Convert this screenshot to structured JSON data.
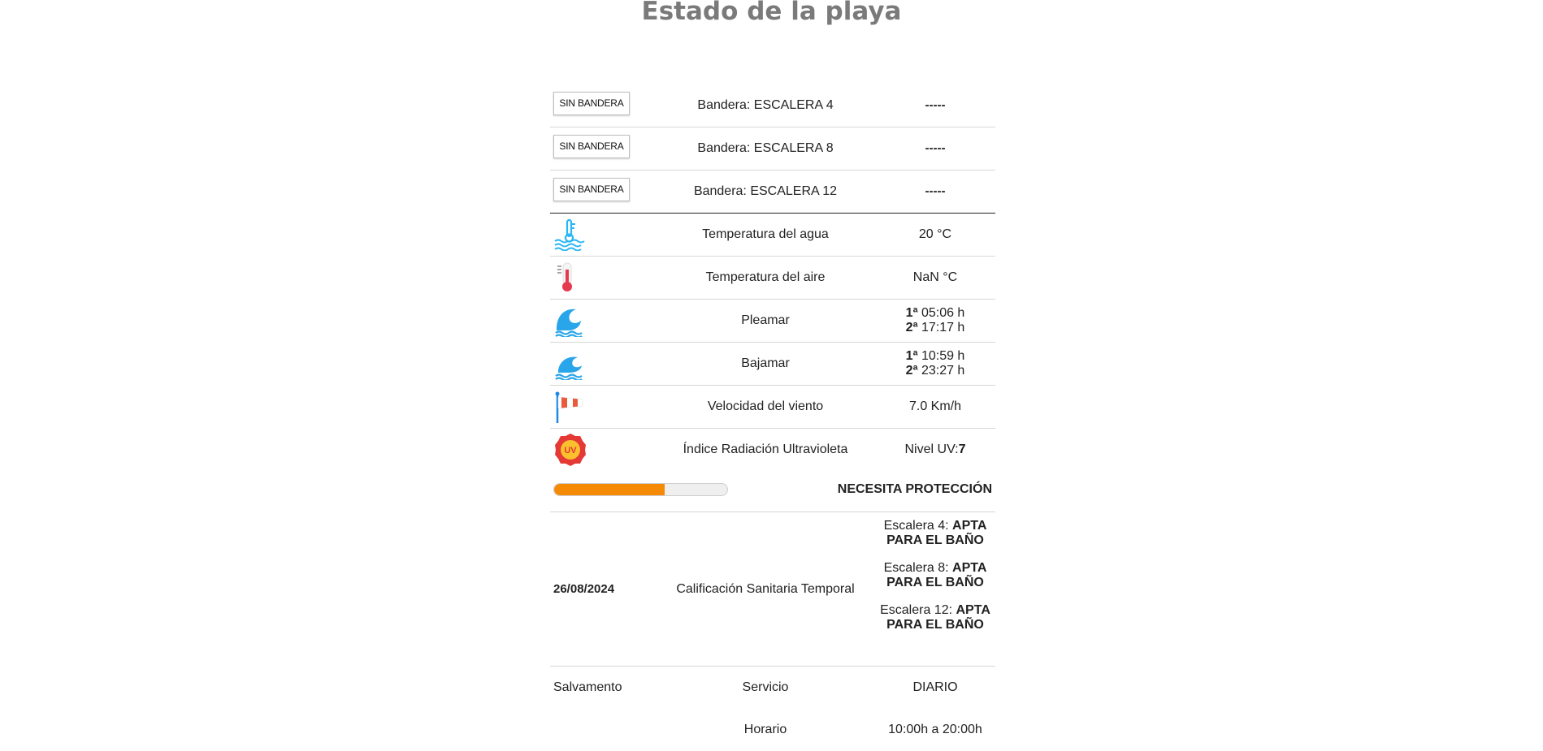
{
  "page_title": "Estado de la playa",
  "flags": [
    {
      "badge": "SIN BANDERA",
      "label": "Bandera: ESCALERA 4",
      "value": "-----"
    },
    {
      "badge": "SIN BANDERA",
      "label": "Bandera: ESCALERA 8",
      "value": "-----"
    },
    {
      "badge": "SIN BANDERA",
      "label": "Bandera: ESCALERA 12",
      "value": "-----"
    }
  ],
  "water_temp": {
    "icon": "water-thermometer-icon",
    "label": "Temperatura del agua",
    "value": "20 °C"
  },
  "air_temp": {
    "icon": "thermometer-icon",
    "label": "Temperatura del aire",
    "value": "NaN °C"
  },
  "high_tide": {
    "icon": "wave-icon",
    "label": "Pleamar",
    "first_ord": "1ª",
    "first_time": " 05:06 h",
    "second_ord": "2ª",
    "second_time": " 17:17 h"
  },
  "low_tide": {
    "icon": "low-wave-icon",
    "label": "Bajamar",
    "first_ord": "1ª",
    "first_time": " 10:59 h",
    "second_ord": "2ª",
    "second_time": " 23:27 h"
  },
  "wind": {
    "icon": "windsock-icon",
    "label": "Velocidad del viento",
    "value": "7.0 Km/h"
  },
  "uv": {
    "icon": "uv-icon",
    "icon_text": "UV",
    "label": "Índice Radiación Ultravioleta",
    "value_prefix": "Nivel UV: ",
    "value": "7",
    "level_fraction": 0.64,
    "status": "NECESITA PROTECCIÓN",
    "bar_color": "#f58a07"
  },
  "calificacion": {
    "date": "26/08/2024",
    "label": "Calificación Sanitaria Temporal",
    "items": [
      {
        "name": "Escalera 4: ",
        "status": "APTA PARA EL BAÑO"
      },
      {
        "name": "Escalera 8: ",
        "status": "APTA PARA EL BAÑO"
      },
      {
        "name": "Escalera 12: ",
        "status": "APTA PARA EL BAÑO"
      }
    ]
  },
  "salvamento": {
    "label": "Salvamento",
    "service_label": "Servicio",
    "service_value": "DIARIO",
    "hours_label": "Horario",
    "hours_value": "10:00h a 20:00h"
  }
}
